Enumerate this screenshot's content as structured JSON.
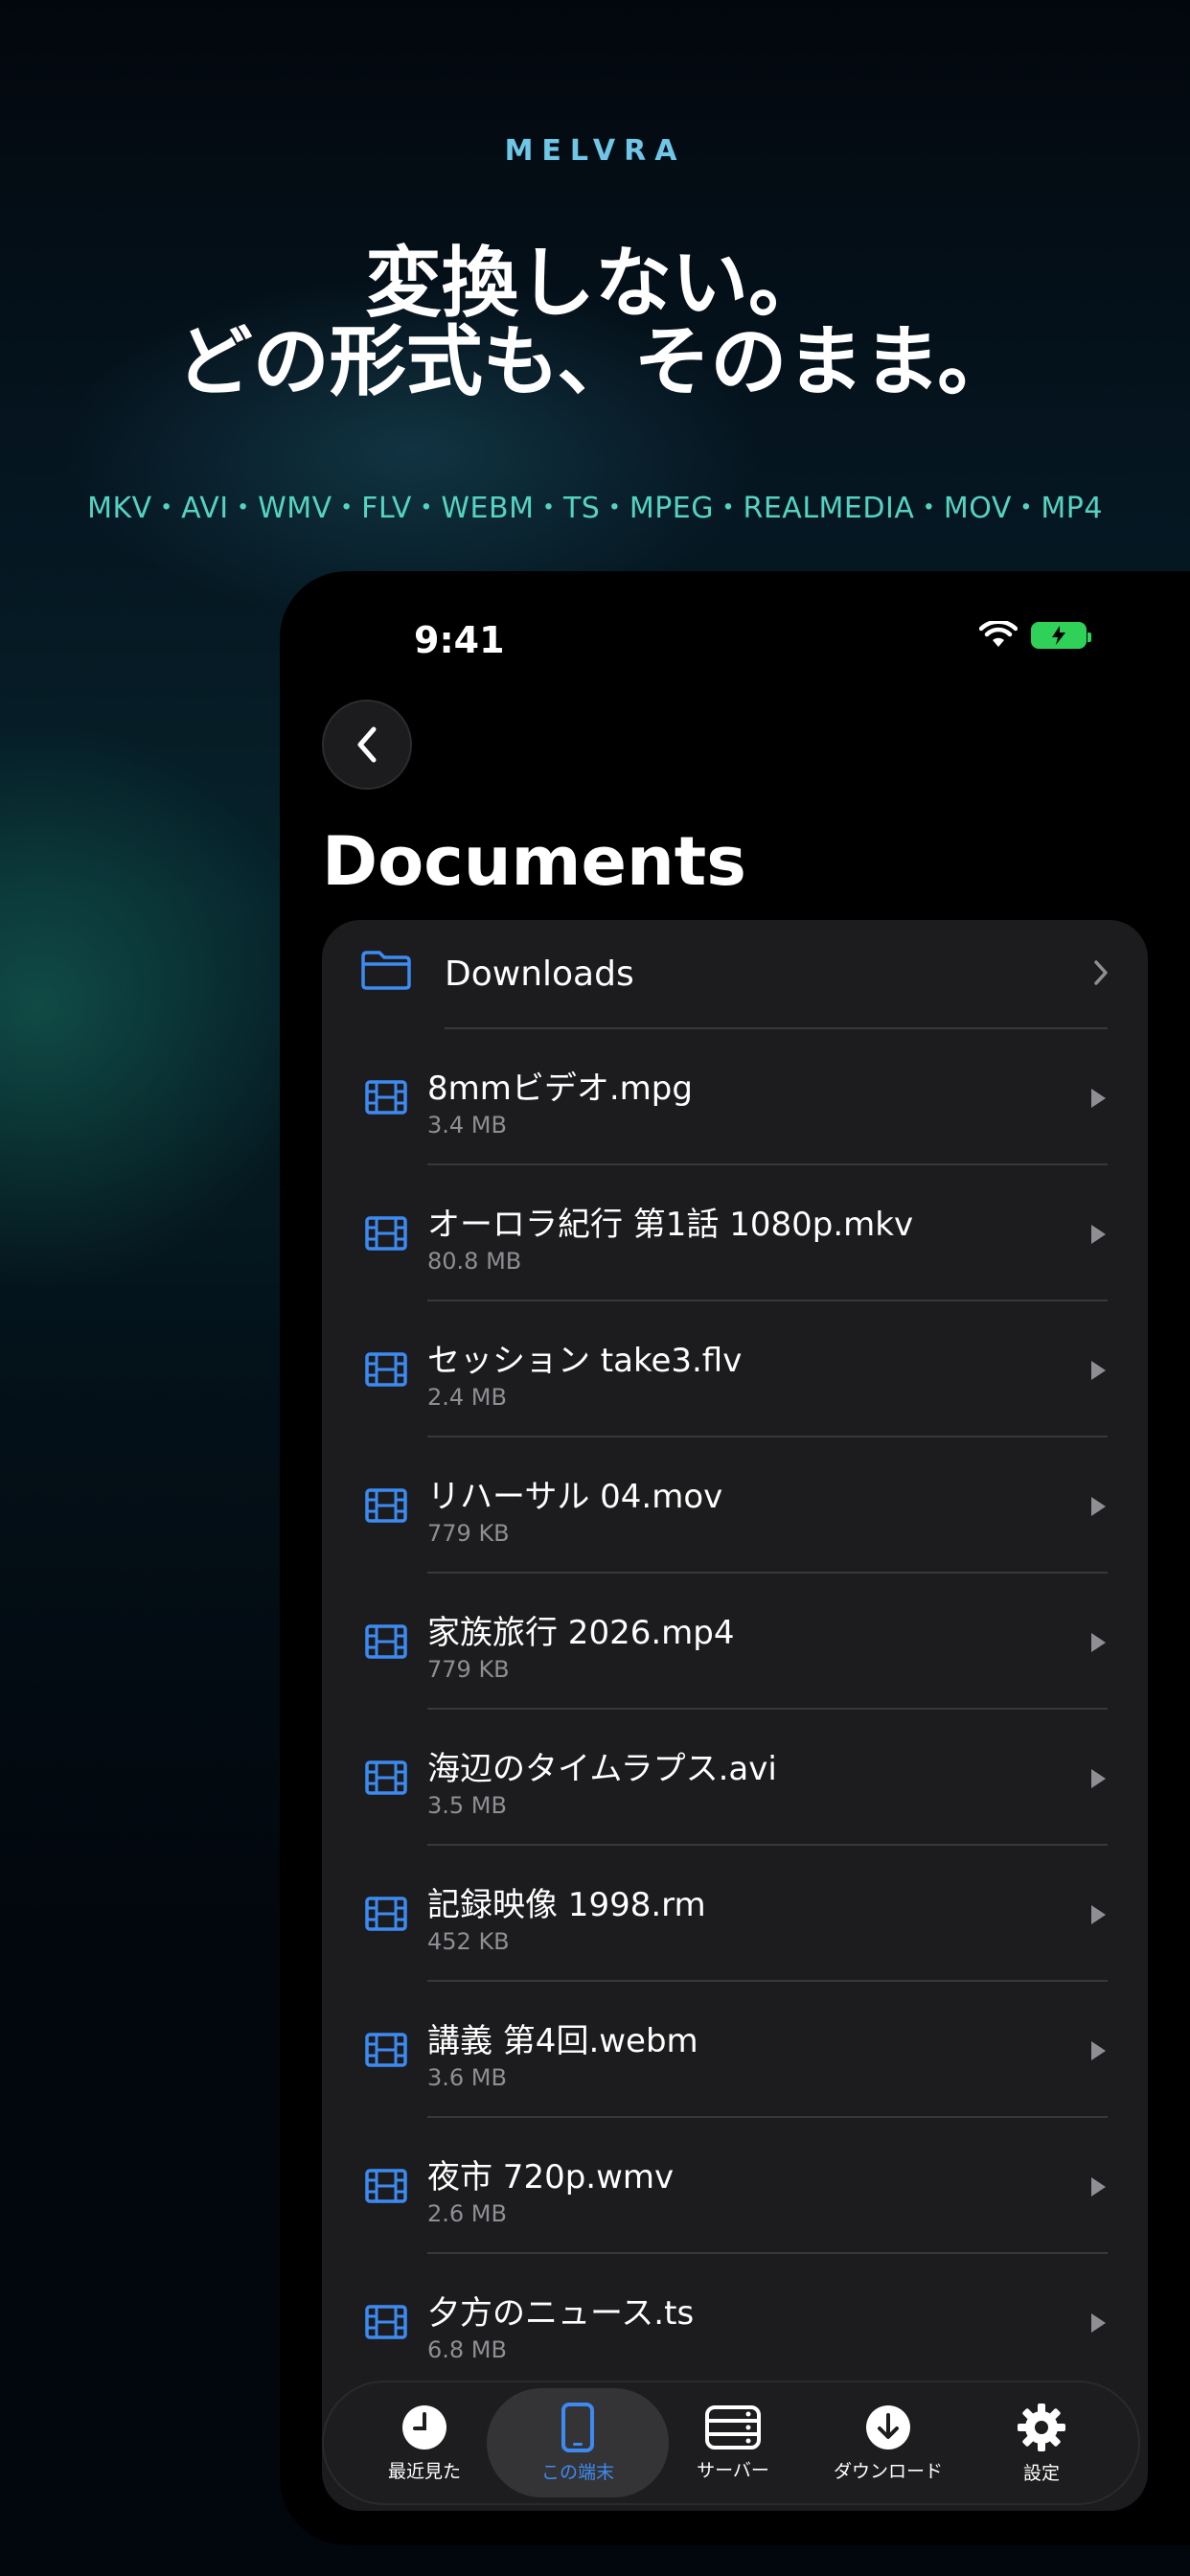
{
  "brand": "MELVRA",
  "headline": {
    "line1": "変換しない。",
    "line2": "どの形式も、そのまま。"
  },
  "formats": "MKV・AVI・WMV・FLV・WEBM・TS・MPEG・REALMEDIA・MOV・MP4",
  "status": {
    "time": "9:41"
  },
  "page_title": "Documents",
  "folder": {
    "label": "Downloads"
  },
  "files": [
    {
      "name": "8mmビデオ.mpg",
      "size": "3.4 MB"
    },
    {
      "name": "オーロラ紀行 第1話 1080p.mkv",
      "size": "80.8 MB"
    },
    {
      "name": "セッション take3.flv",
      "size": "2.4 MB"
    },
    {
      "name": "リハーサル 04.mov",
      "size": "779 KB"
    },
    {
      "name": "家族旅行 2026.mp4",
      "size": "779 KB"
    },
    {
      "name": "海辺のタイムラプス.avi",
      "size": "3.5 MB"
    },
    {
      "name": "記録映像 1998.rm",
      "size": "452 KB"
    },
    {
      "name": "講義 第4回.webm",
      "size": "3.6 MB"
    },
    {
      "name": "夜市 720p.wmv",
      "size": "2.6 MB"
    },
    {
      "name": "夕方のニュース.ts",
      "size": "6.8 MB"
    }
  ],
  "tabs": [
    {
      "label": "最近見た",
      "icon": "clock-icon"
    },
    {
      "label": "この端末",
      "icon": "phone-icon",
      "active": true
    },
    {
      "label": "サーバー",
      "icon": "server-icon"
    },
    {
      "label": "ダウンロード",
      "icon": "download-icon"
    },
    {
      "label": "設定",
      "icon": "gear-icon"
    }
  ],
  "colors": {
    "accent": "#3d8bf2",
    "brand": "#6fc6e6",
    "formats": "#55d3c2",
    "battery": "#30d158"
  }
}
